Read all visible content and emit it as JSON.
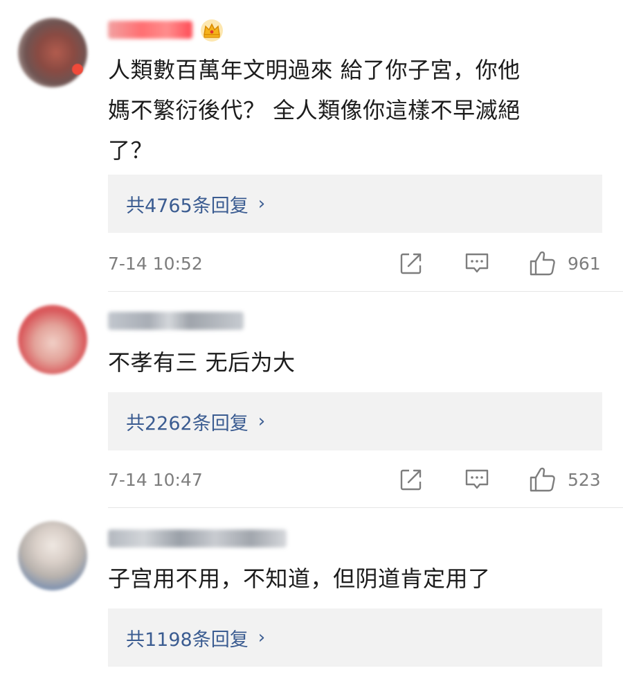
{
  "comments": [
    {
      "content": "人類數百萬年文明過來 給了你子宮，你他\n媽不繁衍後代？ 全人類像你這樣不早滅絕\n了？",
      "replies_label": "共4765条回复",
      "timestamp": "7-14 10:52",
      "likes": "961"
    },
    {
      "content": "不孝有三 无后为大",
      "replies_label": "共2262条回复",
      "timestamp": "7-14 10:47",
      "likes": "523"
    },
    {
      "content": "子宫用不用，不知道，但阴道肯定用了",
      "replies_label": "共1198条回复"
    }
  ],
  "icons": {
    "chevron": "›",
    "share": "share-icon",
    "comment": "comment-icon",
    "like": "thumbs-up-icon",
    "crown": "crown-icon"
  },
  "colors": {
    "reply_link": "#3b5c91",
    "meta_text": "#7d7d7d",
    "reply_box_bg": "#f2f2f2",
    "crown": "#f5b21c"
  }
}
